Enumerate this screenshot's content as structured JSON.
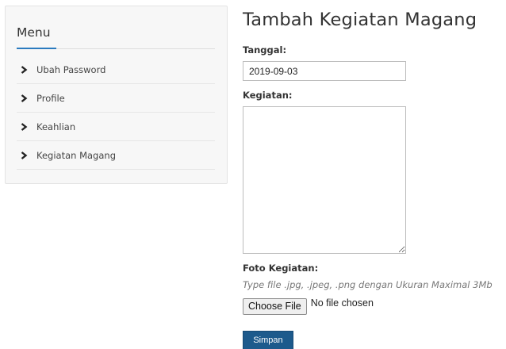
{
  "sidebar": {
    "title": "Menu",
    "accent_color": "#2b7bbf",
    "items": [
      {
        "label": "Ubah Password",
        "icon": "chevron-right-icon"
      },
      {
        "label": "Profile",
        "icon": "chevron-right-icon"
      },
      {
        "label": "Keahlian",
        "icon": "chevron-right-icon"
      },
      {
        "label": "Kegiatan Magang",
        "icon": "chevron-right-icon"
      }
    ]
  },
  "form": {
    "title": "Tambah Kegiatan Magang",
    "tanggal_label": "Tanggal:",
    "tanggal_value": "2019-09-03",
    "kegiatan_label": "Kegiatan:",
    "kegiatan_value": "",
    "foto_label": "Foto Kegiatan:",
    "foto_hint": "Type file .jpg, .jpeg, .png dengan Ukuran Maximal 3Mb",
    "choose_file_label": "Choose File",
    "file_status": "No file chosen",
    "submit_label": "Simpan",
    "submit_color": "#1d5a8c"
  }
}
